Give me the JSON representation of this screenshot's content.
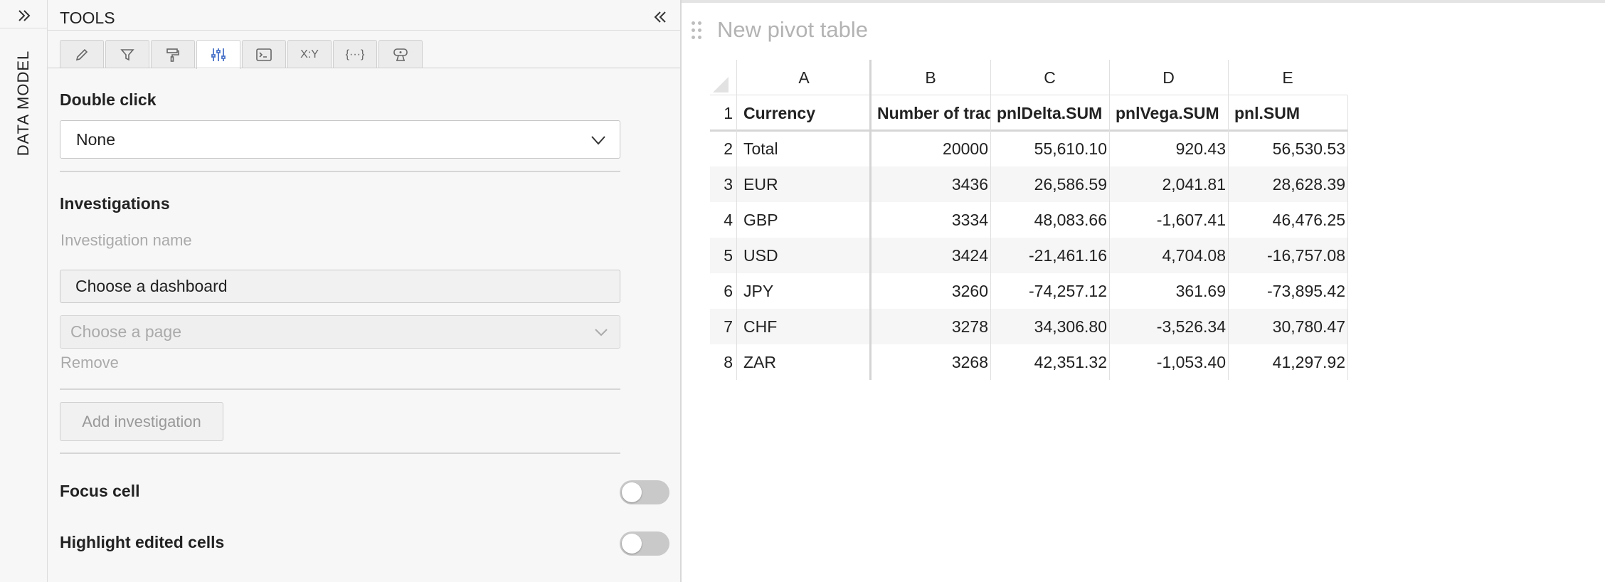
{
  "rail": {
    "label": "DATA MODEL"
  },
  "panel": {
    "title": "TOOLS",
    "tabs": [
      {
        "icon": "pencil-icon",
        "active": false
      },
      {
        "icon": "filter-icon",
        "active": false
      },
      {
        "icon": "paint-roller-icon",
        "active": false
      },
      {
        "icon": "sliders-icon",
        "active": true
      },
      {
        "icon": "terminal-icon",
        "active": false
      },
      {
        "icon": "xy-icon",
        "label": "X:Y",
        "active": false
      },
      {
        "icon": "braces-icon",
        "label": "{···}",
        "active": false
      },
      {
        "icon": "widget-icon",
        "active": false
      }
    ],
    "double_click": {
      "label": "Double click",
      "value": "None"
    },
    "investigations": {
      "label": "Investigations",
      "name_placeholder": "Investigation name",
      "dashboard_button": "Choose a dashboard",
      "page_placeholder": "Choose a page",
      "remove_label": "Remove",
      "add_button": "Add investigation"
    },
    "focus_cell": {
      "label": "Focus cell",
      "on": false
    },
    "highlight_edited": {
      "label": "Highlight edited cells",
      "on": false
    }
  },
  "main": {
    "title": "New pivot table",
    "columns": [
      "A",
      "B",
      "C",
      "D",
      "E"
    ],
    "row_numbers": [
      "1",
      "2",
      "3",
      "4",
      "5",
      "6",
      "7",
      "8"
    ],
    "header": [
      "Currency",
      "Number of trades",
      "pnlDelta.SUM",
      "pnlVega.SUM",
      "pnl.SUM"
    ],
    "rows": [
      [
        "Total",
        "20000",
        "55,610.10",
        "920.43",
        "56,530.53"
      ],
      [
        "EUR",
        "3436",
        "26,586.59",
        "2,041.81",
        "28,628.39"
      ],
      [
        "GBP",
        "3334",
        "48,083.66",
        "-1,607.41",
        "46,476.25"
      ],
      [
        "USD",
        "3424",
        "-21,461.16",
        "4,704.08",
        "-16,757.08"
      ],
      [
        "JPY",
        "3260",
        "-74,257.12",
        "361.69",
        "-73,895.42"
      ],
      [
        "CHF",
        "3278",
        "34,306.80",
        "-3,526.34",
        "30,780.47"
      ],
      [
        "ZAR",
        "3268",
        "42,351.32",
        "-1,053.40",
        "41,297.92"
      ]
    ]
  }
}
